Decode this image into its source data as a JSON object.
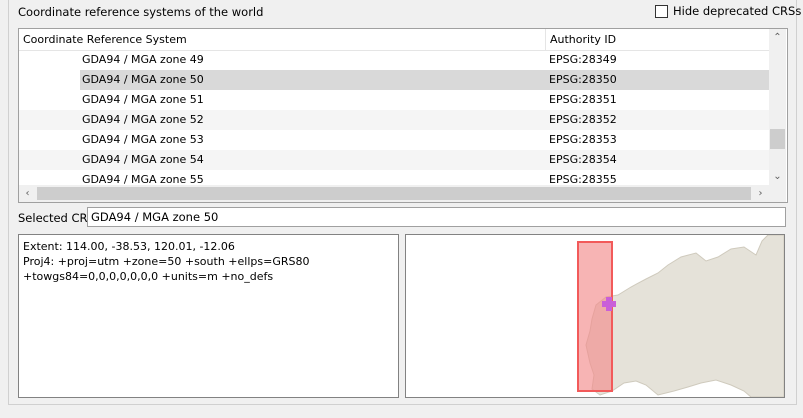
{
  "group": {
    "title": "Coordinate reference systems of the world"
  },
  "hide_deprecated": {
    "label": "Hide deprecated CRSs",
    "checked": false
  },
  "table": {
    "columns": [
      "Coordinate Reference System",
      "Authority ID"
    ],
    "rows": [
      {
        "name": "GDA94 / MGA zone 49",
        "auth": "EPSG:28349",
        "selected": false
      },
      {
        "name": "GDA94 / MGA zone 50",
        "auth": "EPSG:28350",
        "selected": true
      },
      {
        "name": "GDA94 / MGA zone 51",
        "auth": "EPSG:28351",
        "selected": false
      },
      {
        "name": "GDA94 / MGA zone 52",
        "auth": "EPSG:28352",
        "selected": false
      },
      {
        "name": "GDA94 / MGA zone 53",
        "auth": "EPSG:28353",
        "selected": false
      },
      {
        "name": "GDA94 / MGA zone 54",
        "auth": "EPSG:28354",
        "selected": false
      },
      {
        "name": "GDA94 / MGA zone 55",
        "auth": "EPSG:28355",
        "selected": false
      }
    ]
  },
  "selected_crs": {
    "label": "Selected CRS",
    "value": "GDA94 / MGA zone 50"
  },
  "info": {
    "extent": "Extent: 114.00, -38.53, 120.01, -12.06",
    "proj4_line1": "Proj4: +proj=utm +zone=50 +south +ellps=GRS80",
    "proj4_line2": "+towgs84=0,0,0,0,0,0,0 +units=m +no_defs"
  },
  "colors": {
    "land": "#e5e2d9",
    "extent_fill": "#f28c8c",
    "extent_stroke": "#f25a5a",
    "marker": "#c95fd9",
    "selection": "#d9d9d9"
  }
}
